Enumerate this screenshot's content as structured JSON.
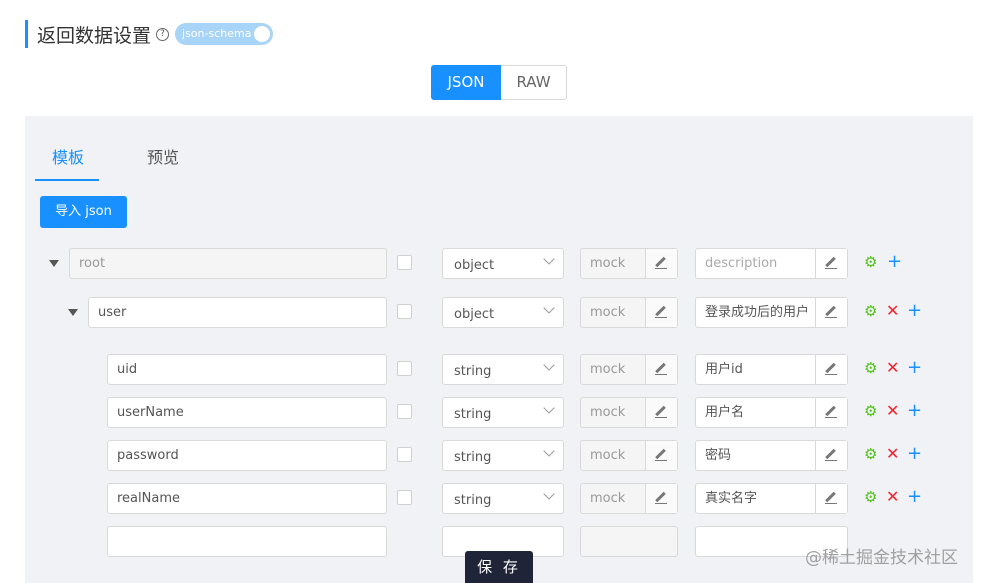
{
  "header": {
    "title": "返回数据设置",
    "help_icon": "?",
    "switch_label": "json-schema"
  },
  "segment": {
    "json": "JSON",
    "raw": "RAW"
  },
  "tabs": {
    "template": "模板",
    "preview": "预览"
  },
  "import_button": "导入 json",
  "rows": [
    {
      "name": "root",
      "type": "object",
      "mock": "mock",
      "desc": "description",
      "desc_placeholder": true
    },
    {
      "name": "user",
      "type": "object",
      "mock": "mock",
      "desc": "登录成功后的用户",
      "desc_placeholder": false
    },
    {
      "name": "uid",
      "type": "string",
      "mock": "mock",
      "desc": "用户id",
      "desc_placeholder": false
    },
    {
      "name": "userName",
      "type": "string",
      "mock": "mock",
      "desc": "用户名",
      "desc_placeholder": false
    },
    {
      "name": "password",
      "type": "string",
      "mock": "mock",
      "desc": "密码",
      "desc_placeholder": false
    },
    {
      "name": "realName",
      "type": "string",
      "mock": "mock",
      "desc": "真实名字",
      "desc_placeholder": false
    }
  ],
  "icons": {
    "settings": "gear-icon",
    "delete": "close-icon",
    "add": "plus-icon",
    "edit": "edit-icon"
  },
  "colors": {
    "primary": "#1890ff",
    "save": "#1f2438",
    "gear": "#52c41a",
    "delete": "#f5222d"
  },
  "save_button": "保 存",
  "watermark": "@稀土掘金技术社区"
}
